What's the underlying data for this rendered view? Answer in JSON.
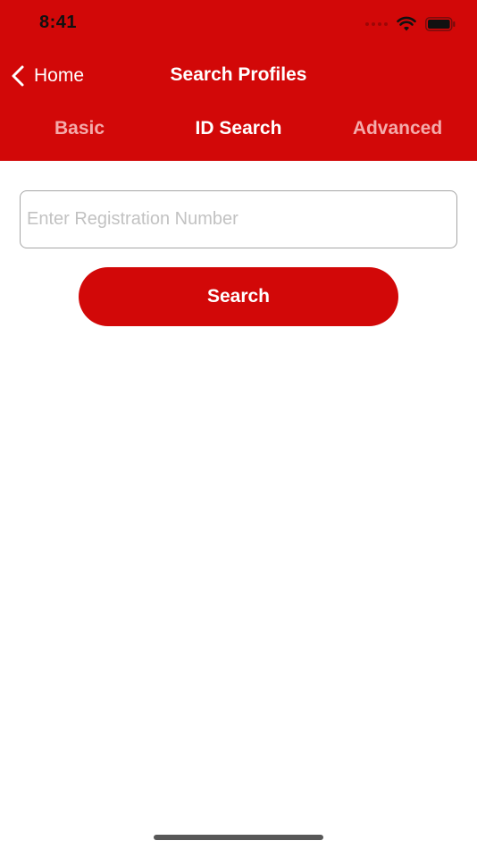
{
  "status_bar": {
    "time": "8:41"
  },
  "nav": {
    "back_label": "Home",
    "title": "Search Profiles"
  },
  "tabs": [
    {
      "label": "Basic",
      "active": false
    },
    {
      "label": "ID Search",
      "active": true
    },
    {
      "label": "Advanced",
      "active": false
    }
  ],
  "form": {
    "registration_placeholder": "Enter Registration Number",
    "registration_value": "",
    "search_label": "Search"
  },
  "colors": {
    "brand_red": "#d20808",
    "inactive_tab": "#f4aaaa"
  }
}
